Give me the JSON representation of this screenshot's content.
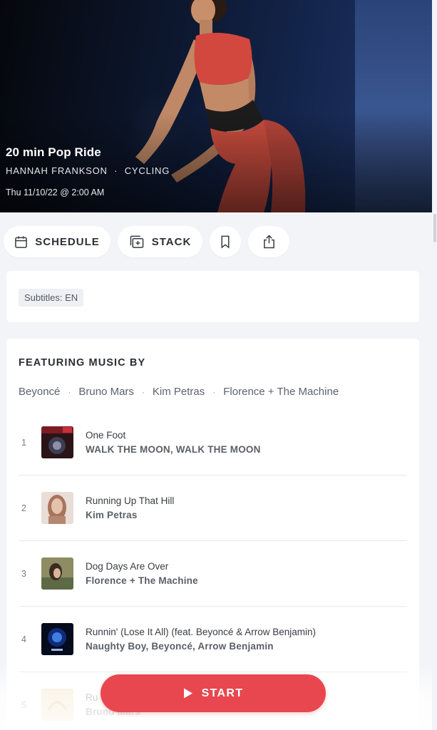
{
  "hero": {
    "title": "20 min Pop Ride",
    "instructor": "HANNAH FRANKSON",
    "separator": "·",
    "category": "CYCLING",
    "datetime": "Thu 11/10/22 @ 2:00 AM"
  },
  "actions": {
    "schedule_label": "SCHEDULE",
    "stack_label": "STACK"
  },
  "subtitles": {
    "label": "Subtitles: EN"
  },
  "music": {
    "heading": "FEATURING MUSIC BY",
    "artists": [
      "Beyoncé",
      "Bruno Mars",
      "Kim Petras",
      "Florence + The Machine"
    ],
    "dot": "·",
    "tracks": [
      {
        "number": "1",
        "title": "One Foot",
        "artist": "WALK THE MOON, WALK THE MOON"
      },
      {
        "number": "2",
        "title": "Running Up That Hill",
        "artist": "Kim Petras"
      },
      {
        "number": "3",
        "title": "Dog Days Are Over",
        "artist": "Florence + The Machine"
      },
      {
        "number": "4",
        "title": "Runnin' (Lose It All) (feat. Beyoncé & Arrow Benjamin)",
        "artist": "Naughty Boy, Beyoncé, Arrow Benjamin"
      },
      {
        "number": "5",
        "title": "Ru",
        "artist": "Bruno Mars"
      }
    ]
  },
  "start": {
    "label": "START"
  },
  "colors": {
    "accent": "#e8474f",
    "background": "#f3f4f8"
  },
  "icons": {
    "schedule": "calendar-icon",
    "stack": "stack-add-icon",
    "bookmark": "bookmark-icon",
    "share": "share-icon",
    "start": "play-icon"
  }
}
